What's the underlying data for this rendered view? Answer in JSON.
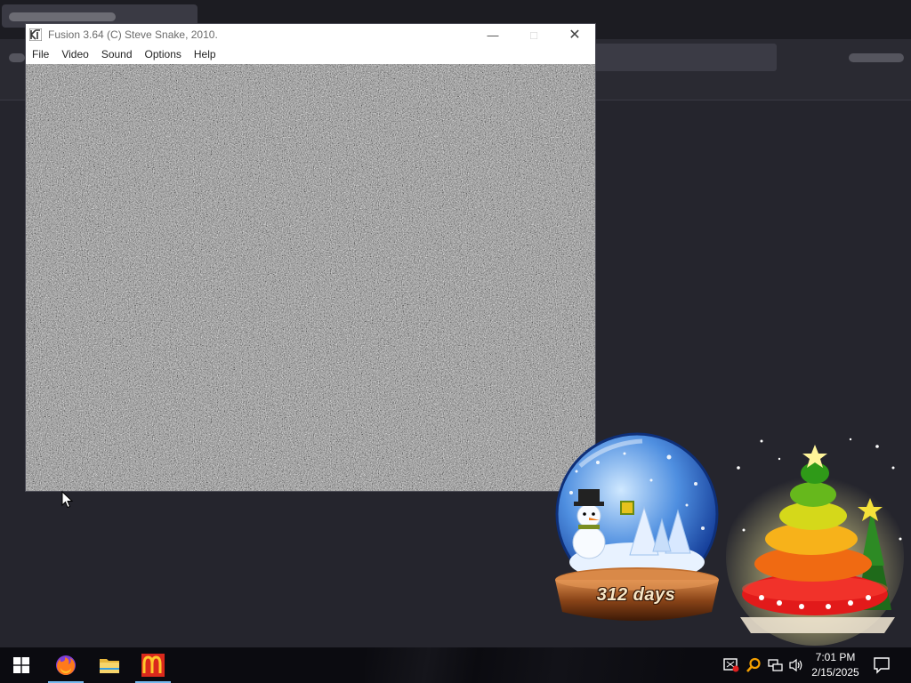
{
  "window": {
    "title": "Fusion 3.64 (C) Steve Snake, 2010.",
    "controls": {
      "minimize": "—",
      "maximize": "□",
      "close": "✕"
    },
    "menu": [
      "File",
      "Video",
      "Sound",
      "Options",
      "Help"
    ],
    "screen_content": "static-noise"
  },
  "desktop": {
    "globe_widget": {
      "days_label": "312 days"
    },
    "tree_widget": {
      "icon": "christmas-tree"
    }
  },
  "taskbar": {
    "start": {
      "icon": "windows-logo-icon"
    },
    "apps": [
      {
        "name": "Firefox",
        "icon": "firefox-icon",
        "active": true
      },
      {
        "name": "File Explorer",
        "icon": "folder-icon",
        "active": false
      },
      {
        "name": "McDonald's",
        "icon": "mcdonalds-icon",
        "active": true
      }
    ],
    "tray": {
      "icons": [
        "security-alert-icon",
        "search-icon",
        "network-icon",
        "volume-icon"
      ],
      "time": "7:01 PM",
      "date": "2/15/2025"
    }
  },
  "colors": {
    "taskbar": "#0b0b10",
    "desktop": "#22222a",
    "active_indicator": "#76b9ed",
    "mcd_red": "#da291c",
    "mcd_yellow": "#ffc72c"
  }
}
